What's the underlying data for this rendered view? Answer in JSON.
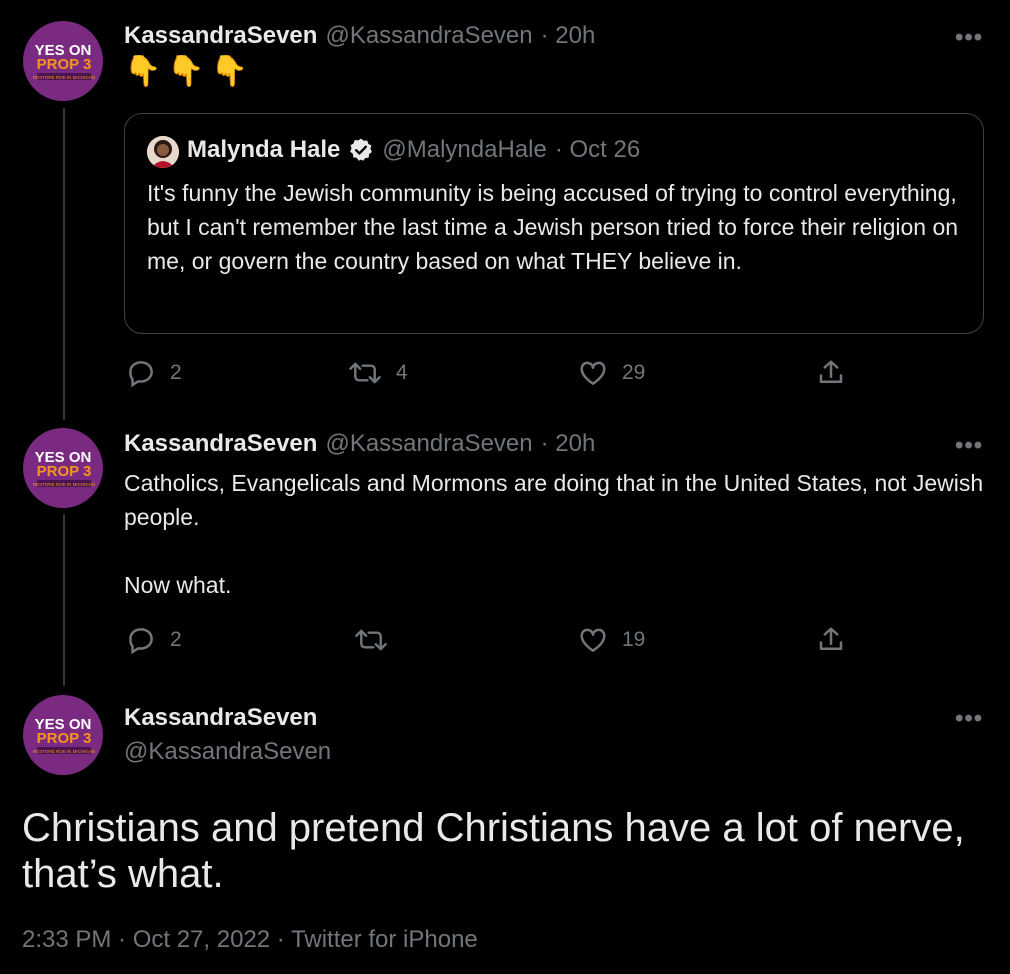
{
  "tweets": [
    {
      "name": "KassandraSeven",
      "handle": "@KassandraSeven",
      "time": "· 20h",
      "text": "👇👇👇",
      "quote": {
        "name": "Malynda Hale",
        "handle": "@MalyndaHale",
        "time": "· Oct 26",
        "text": "It's funny the Jewish community is being accused of trying to control everything, but I can't remember the last time a Jewish person tried to force their religion on me, or govern the country based on what THEY believe in."
      },
      "replies": "2",
      "retweets": "4",
      "likes": "29"
    },
    {
      "name": "KassandraSeven",
      "handle": "@KassandraSeven",
      "time": "· 20h",
      "text": "Catholics, Evangelicals and Mormons are doing that in the United States, not Jewish people.\n\nNow what.",
      "replies": "2",
      "retweets": "",
      "likes": "19"
    }
  ],
  "main_tweet": {
    "name": "KassandraSeven",
    "handle": "@KassandraSeven",
    "text": "Christians and pretend Christians have a lot of nerve, that’s what.",
    "meta": "2:33 PM · Oct 27, 2022 · Twitter for iPhone"
  },
  "avatar_badge": {
    "line1": "YES ON",
    "line2": "PROP 3",
    "line3": "RESTORE ROE IN MICHIGAN"
  },
  "more_label": "•••",
  "colors": {
    "background": "#000000",
    "text": "#e7e9ea",
    "muted": "#71767b",
    "avatar_purple": "#7b2a82",
    "badge_orange": "#f7941d",
    "verified": "#e7e9ea"
  },
  "icons": [
    "reply-icon",
    "retweet-icon",
    "like-icon",
    "share-icon",
    "verified-icon",
    "more-icon"
  ]
}
